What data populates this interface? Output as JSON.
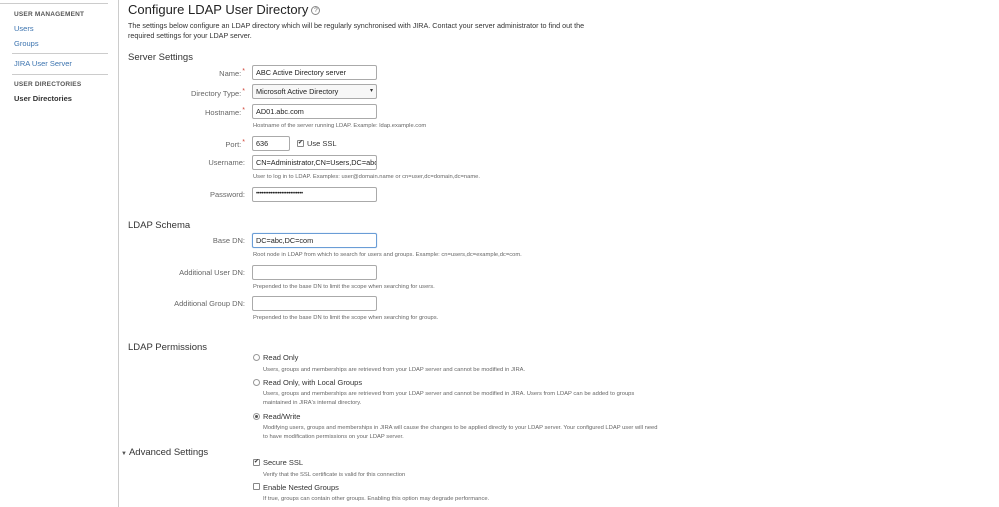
{
  "sidebar": {
    "user_management_heading": "USER MANAGEMENT",
    "users": "Users",
    "groups": "Groups",
    "jira_user_server": "JIRA User Server",
    "user_directories_heading": "USER DIRECTORIES",
    "user_directories": "User Directories"
  },
  "page": {
    "title": "Configure LDAP User Directory",
    "help_icon": "?",
    "intro": "The settings below configure an LDAP directory which will be regularly synchronised with JIRA. Contact your server administrator to find out the required settings for your LDAP server."
  },
  "server_settings": {
    "title": "Server Settings",
    "name_label": "Name:",
    "name_value": "ABC Active Directory server",
    "directory_type_label": "Directory Type:",
    "directory_type_value": "Microsoft Active Directory",
    "hostname_label": "Hostname:",
    "hostname_value": "AD01.abc.com",
    "hostname_hint": "Hostname of the server running LDAP. Example: ldap.example.com",
    "port_label": "Port:",
    "port_value": "636",
    "use_ssl_label": "Use SSL",
    "use_ssl_checked": true,
    "username_label": "Username:",
    "username_value": "CN=Administrator,CN=Users,DC=abc,DC=com",
    "username_hint": "User to log in to LDAP. Examples: user@domain.name or cn=user,dc=domain,dc=name.",
    "password_label": "Password:",
    "password_value": "••••••••••••••••••••••••••"
  },
  "ldap_schema": {
    "title": "LDAP Schema",
    "base_dn_label": "Base DN:",
    "base_dn_value": "DC=abc,DC=com",
    "base_dn_hint": "Root node in LDAP from which to search for users and groups. Example: cn=users,dc=example,dc=com.",
    "additional_user_dn_label": "Additional User DN:",
    "additional_user_dn_value": "",
    "additional_user_dn_hint": "Prepended to the base DN to limit the scope when searching for users.",
    "additional_group_dn_label": "Additional Group DN:",
    "additional_group_dn_value": "",
    "additional_group_dn_hint": "Prepended to the base DN to limit the scope when searching for groups."
  },
  "ldap_permissions": {
    "title": "LDAP Permissions",
    "selected": "Read/Write",
    "options": [
      {
        "label": "Read Only",
        "desc": "Users, groups and memberships are retrieved from your LDAP server and cannot be modified in JIRA."
      },
      {
        "label": "Read Only, with Local Groups",
        "desc": "Users, groups and memberships are retrieved from your LDAP server and cannot be modified in JIRA. Users from LDAP can be added to groups maintained in JIRA's internal directory."
      },
      {
        "label": "Read/Write",
        "desc": "Modifying users, groups and memberships in JIRA will cause the changes to be applied directly to your LDAP server. Your configured LDAP user will need to have modification permissions on your LDAP server."
      }
    ]
  },
  "advanced_settings": {
    "title": "Advanced Settings",
    "expand_icon": "▼",
    "secure_ssl_label": "Secure SSL",
    "secure_ssl_checked": true,
    "secure_ssl_hint": "Verify that the SSL certificate is valid for this connection",
    "nested_groups_label": "Enable Nested Groups",
    "nested_groups_checked": false,
    "nested_groups_hint": "If true, groups can contain other groups. Enabling this option may degrade performance."
  },
  "icons": {
    "check": "✔",
    "select_arrow": "▾"
  }
}
